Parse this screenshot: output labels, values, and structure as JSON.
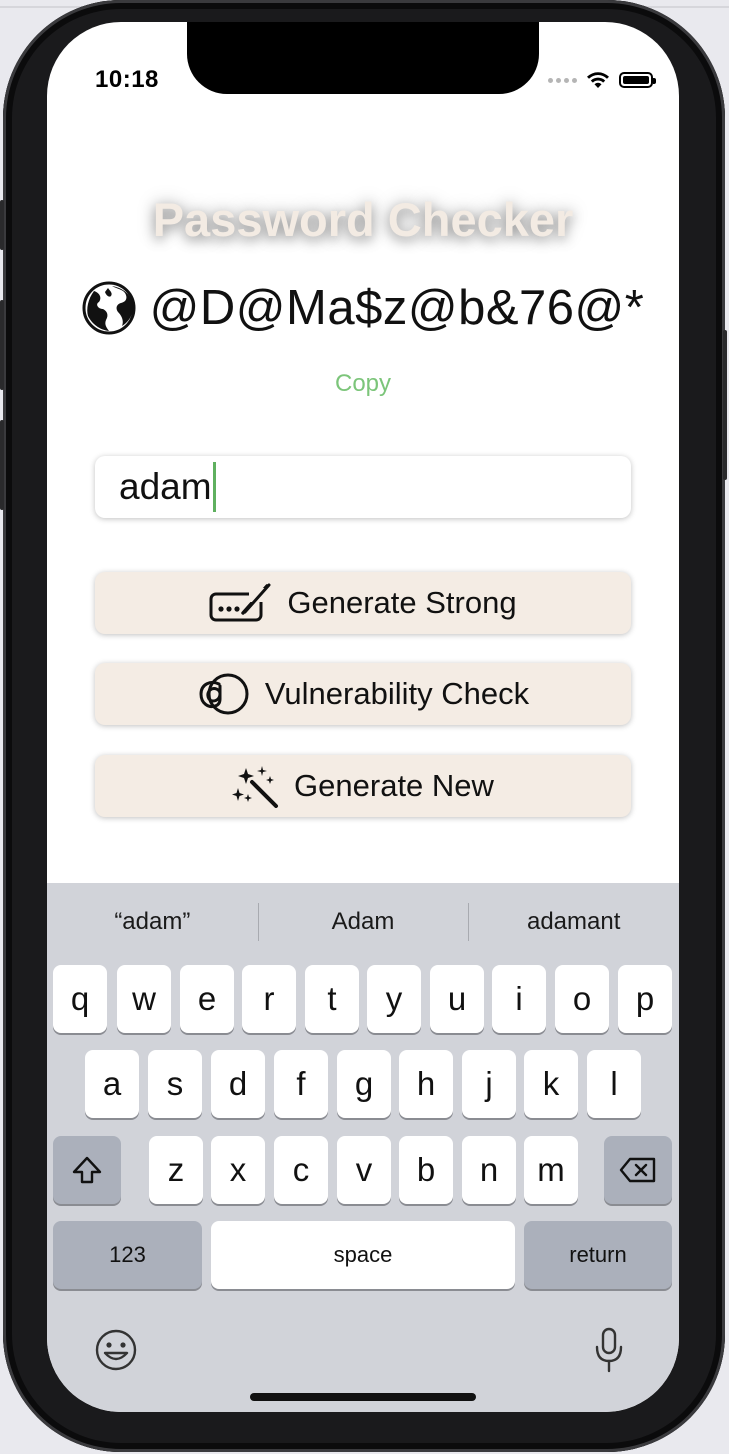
{
  "status_bar": {
    "time": "10:18"
  },
  "app": {
    "title": "Password Checker",
    "generated_password": "@D@Ma$z@b&76@*",
    "copy_label": "Copy",
    "input_value": "adam",
    "buttons": {
      "generate_strong": "Generate Strong",
      "vulnerability_check": "Vulnerability Check",
      "generate_new": "Generate New"
    }
  },
  "keyboard": {
    "suggestions": [
      "“adam”",
      "Adam",
      "adamant"
    ],
    "row1": [
      "q",
      "w",
      "e",
      "r",
      "t",
      "y",
      "u",
      "i",
      "o",
      "p"
    ],
    "row2": [
      "a",
      "s",
      "d",
      "f",
      "g",
      "h",
      "j",
      "k",
      "l"
    ],
    "row3": [
      "z",
      "x",
      "c",
      "v",
      "b",
      "n",
      "m"
    ],
    "numbers_label": "123",
    "space_label": "space",
    "return_label": "return"
  },
  "colors": {
    "title": "#f3ebe3",
    "button_bg": "#f4ece4",
    "copy_link": "#7cc57a",
    "keyboard_bg": "#d1d3d9"
  }
}
